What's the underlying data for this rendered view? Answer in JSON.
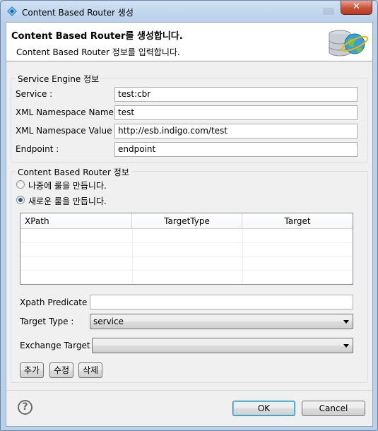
{
  "window": {
    "title": "Content Based Router 생성",
    "close_glyph": "✕"
  },
  "header": {
    "title": "Content Based Router를 생성합니다.",
    "description": "Content Based Router 정보를 입력합니다."
  },
  "service_engine": {
    "group_title": "Service Engine 정보",
    "fields": [
      {
        "label": "Service :",
        "value": "test:cbr"
      },
      {
        "label": "XML Namespace Name :",
        "value": "test"
      },
      {
        "label": "XML Namespace Value :",
        "value": "http://esb.indigo.com/test"
      },
      {
        "label": "Endpoint :",
        "value": "endpoint"
      }
    ]
  },
  "router": {
    "group_title": "Content Based Router 정보",
    "radio_later": {
      "label": "나중에 룰을 만듭니다.",
      "checked": false
    },
    "radio_new": {
      "label": "새로운 룰을 만듭니다.",
      "checked": true
    },
    "table": {
      "columns": [
        "XPath",
        "TargetType",
        "Target"
      ],
      "rows": []
    },
    "xpath_predicate": {
      "label": "Xpath Predicate  :",
      "value": ""
    },
    "target_type": {
      "label": "Target Type  :",
      "value": "service"
    },
    "exchange_target": {
      "label": "Exchange Target  :",
      "value": ""
    },
    "buttons": {
      "add": "추가",
      "edit": "수정",
      "delete": "삭제"
    }
  },
  "footer": {
    "help_glyph": "?",
    "ok": "OK",
    "cancel": "Cancel"
  },
  "colors": {
    "title_bar": "#bcd3ea",
    "close_button": "#c7523a",
    "dialog_bg": "#f0f0f0",
    "header_bg": "#ffffff"
  },
  "icons": {
    "title": "diamond-app-icon",
    "header": "database-globe-icon",
    "help": "help-icon"
  }
}
